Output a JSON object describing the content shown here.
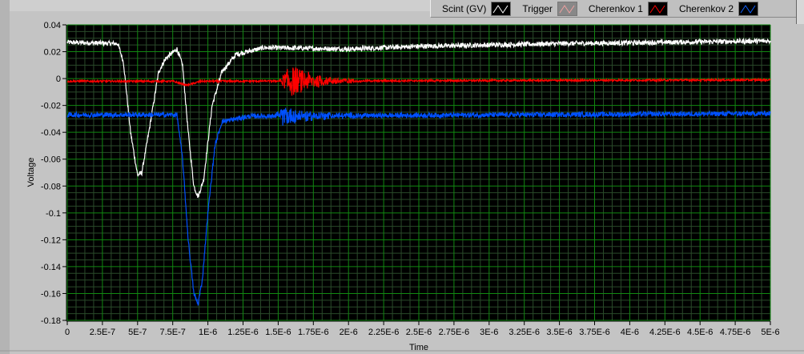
{
  "legend": [
    {
      "name": "Scint (GV)",
      "color": "#ffffff"
    },
    {
      "name": "Trigger",
      "color": "#f08c8c"
    },
    {
      "name": "Cherenkov 1",
      "color": "#ff0000"
    },
    {
      "name": "Cherenkov 2",
      "color": "#0050ff"
    }
  ],
  "chart_data": {
    "type": "line",
    "xlabel": "Time",
    "ylabel": "Voltage",
    "xlim": [
      0,
      5e-06
    ],
    "ylim": [
      -0.18,
      0.04
    ],
    "grid": true,
    "legend_position": "top-right",
    "x_ticks": [
      "0",
      "2.5E-7",
      "5E-7",
      "7.5E-7",
      "1E-6",
      "1.25E-6",
      "1.5E-6",
      "1.75E-6",
      "2E-6",
      "2.25E-6",
      "2.5E-6",
      "2.75E-6",
      "3E-6",
      "3.25E-6",
      "3.5E-6",
      "3.75E-6",
      "4E-6",
      "4.25E-6",
      "4.5E-6",
      "4.75E-6",
      "5E-6"
    ],
    "x_tick_values": [
      0,
      2.5e-07,
      5e-07,
      7.5e-07,
      1e-06,
      1.25e-06,
      1.5e-06,
      1.75e-06,
      2e-06,
      2.25e-06,
      2.5e-06,
      2.75e-06,
      3e-06,
      3.25e-06,
      3.5e-06,
      3.75e-06,
      4e-06,
      4.25e-06,
      4.5e-06,
      4.75e-06,
      5e-06
    ],
    "y_ticks": [
      "0.04",
      "0.02",
      "0",
      "-0.02",
      "-0.04",
      "-0.06",
      "-0.08",
      "-0.1",
      "-0.12",
      "-0.14",
      "-0.16",
      "-0.18"
    ],
    "y_tick_values": [
      0.04,
      0.02,
      0,
      -0.02,
      -0.04,
      -0.06,
      -0.08,
      -0.1,
      -0.12,
      -0.14,
      -0.16,
      -0.18
    ],
    "series": [
      {
        "name": "Scint (GV)",
        "color": "#ffffff",
        "noise": 0.0018,
        "points": [
          [
            0,
            0.027
          ],
          [
            3.6e-07,
            0.026
          ],
          [
            4e-07,
            0.012
          ],
          [
            4.5e-07,
            -0.04
          ],
          [
            5e-07,
            -0.072
          ],
          [
            5.3e-07,
            -0.07
          ],
          [
            5.8e-07,
            -0.04
          ],
          [
            6.5e-07,
            0.005
          ],
          [
            7e-07,
            0.015
          ],
          [
            7.8e-07,
            0.022
          ],
          [
            8.2e-07,
            0.01
          ],
          [
            8.6e-07,
            -0.04
          ],
          [
            9e-07,
            -0.08
          ],
          [
            9.3e-07,
            -0.088
          ],
          [
            9.7e-07,
            -0.075
          ],
          [
            1.03e-06,
            -0.02
          ],
          [
            1.1e-06,
            0.005
          ],
          [
            1.2e-06,
            0.018
          ],
          [
            1.4e-06,
            0.023
          ],
          [
            2e-06,
            0.022
          ],
          [
            2.5e-06,
            0.024
          ],
          [
            3.5e-06,
            0.026
          ],
          [
            5e-06,
            0.028
          ]
        ]
      },
      {
        "name": "Trigger",
        "color": "#f08c8c",
        "noise": 0,
        "points": []
      },
      {
        "name": "Cherenkov 1",
        "color": "#ff0000",
        "noise": 0.0007,
        "points": [
          [
            0,
            -0.002
          ],
          [
            7.5e-07,
            -0.002
          ],
          [
            8.5e-07,
            -0.005
          ],
          [
            9.5e-07,
            -0.002
          ],
          [
            5e-06,
            -0.001
          ]
        ],
        "burst": {
          "start": 1.5e-06,
          "end": 2.1e-06,
          "amplitude": 0.012
        }
      },
      {
        "name": "Cherenkov 2",
        "color": "#0050ff",
        "noise": 0.0018,
        "points": [
          [
            0,
            -0.027
          ],
          [
            7.8e-07,
            -0.027
          ],
          [
            8.2e-07,
            -0.06
          ],
          [
            8.6e-07,
            -0.12
          ],
          [
            9e-07,
            -0.16
          ],
          [
            9.3e-07,
            -0.168
          ],
          [
            9.6e-07,
            -0.15
          ],
          [
            1e-06,
            -0.1
          ],
          [
            1.05e-06,
            -0.05
          ],
          [
            1.1e-06,
            -0.032
          ],
          [
            1.3e-06,
            -0.028
          ],
          [
            5e-06,
            -0.026
          ]
        ],
        "burst": {
          "start": 1.45e-06,
          "end": 2.1e-06,
          "amplitude": 0.007
        }
      }
    ]
  }
}
